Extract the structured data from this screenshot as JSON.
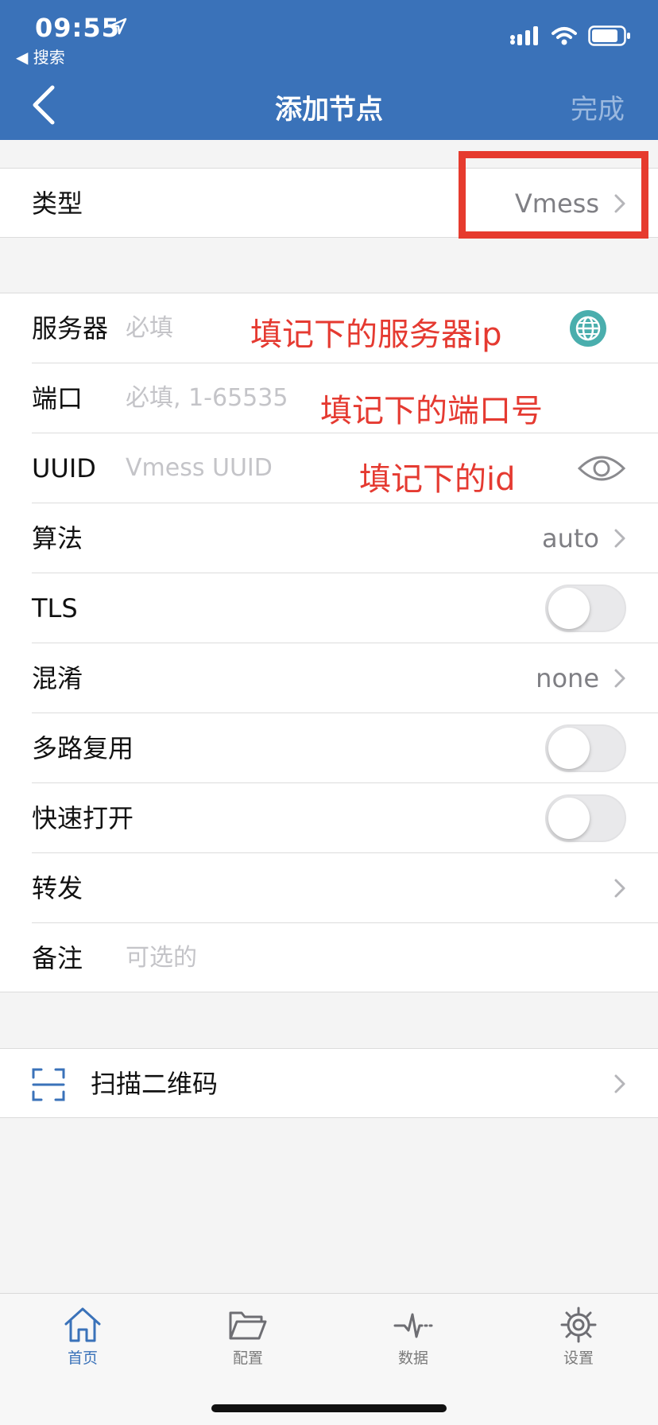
{
  "status_bar": {
    "time": "09:55",
    "back_app": "◀ 搜索"
  },
  "nav": {
    "title": "添加节点",
    "done": "完成"
  },
  "type_row": {
    "label": "类型",
    "value": "Vmess"
  },
  "fields": {
    "server": {
      "label": "服务器",
      "placeholder": "必填"
    },
    "port": {
      "label": "端口",
      "placeholder": "必填, 1-65535"
    },
    "uuid": {
      "label": "UUID",
      "placeholder": "Vmess UUID"
    },
    "algorithm": {
      "label": "算法",
      "value": "auto"
    },
    "tls": {
      "label": "TLS",
      "enabled": false
    },
    "obfs": {
      "label": "混淆",
      "value": "none"
    },
    "mux": {
      "label": "多路复用",
      "enabled": false
    },
    "fast_open": {
      "label": "快速打开",
      "enabled": false
    },
    "forward": {
      "label": "转发"
    },
    "remark": {
      "label": "备注",
      "placeholder": "可选的"
    }
  },
  "scan": {
    "label": "扫描二维码"
  },
  "annotations": {
    "server_note": "填记下的服务器ip",
    "port_note": "填记下的端口号",
    "uuid_note": "填记下的id"
  },
  "tabs": [
    {
      "label": "首页",
      "icon": "home-icon",
      "active": true
    },
    {
      "label": "配置",
      "icon": "folder-icon",
      "active": false
    },
    {
      "label": "数据",
      "icon": "pulse-icon",
      "active": false
    },
    {
      "label": "设置",
      "icon": "gear-icon",
      "active": false
    }
  ],
  "colors": {
    "accent": "#3a72b9",
    "annotation": "#e53a31",
    "globe": "#4aaead"
  }
}
